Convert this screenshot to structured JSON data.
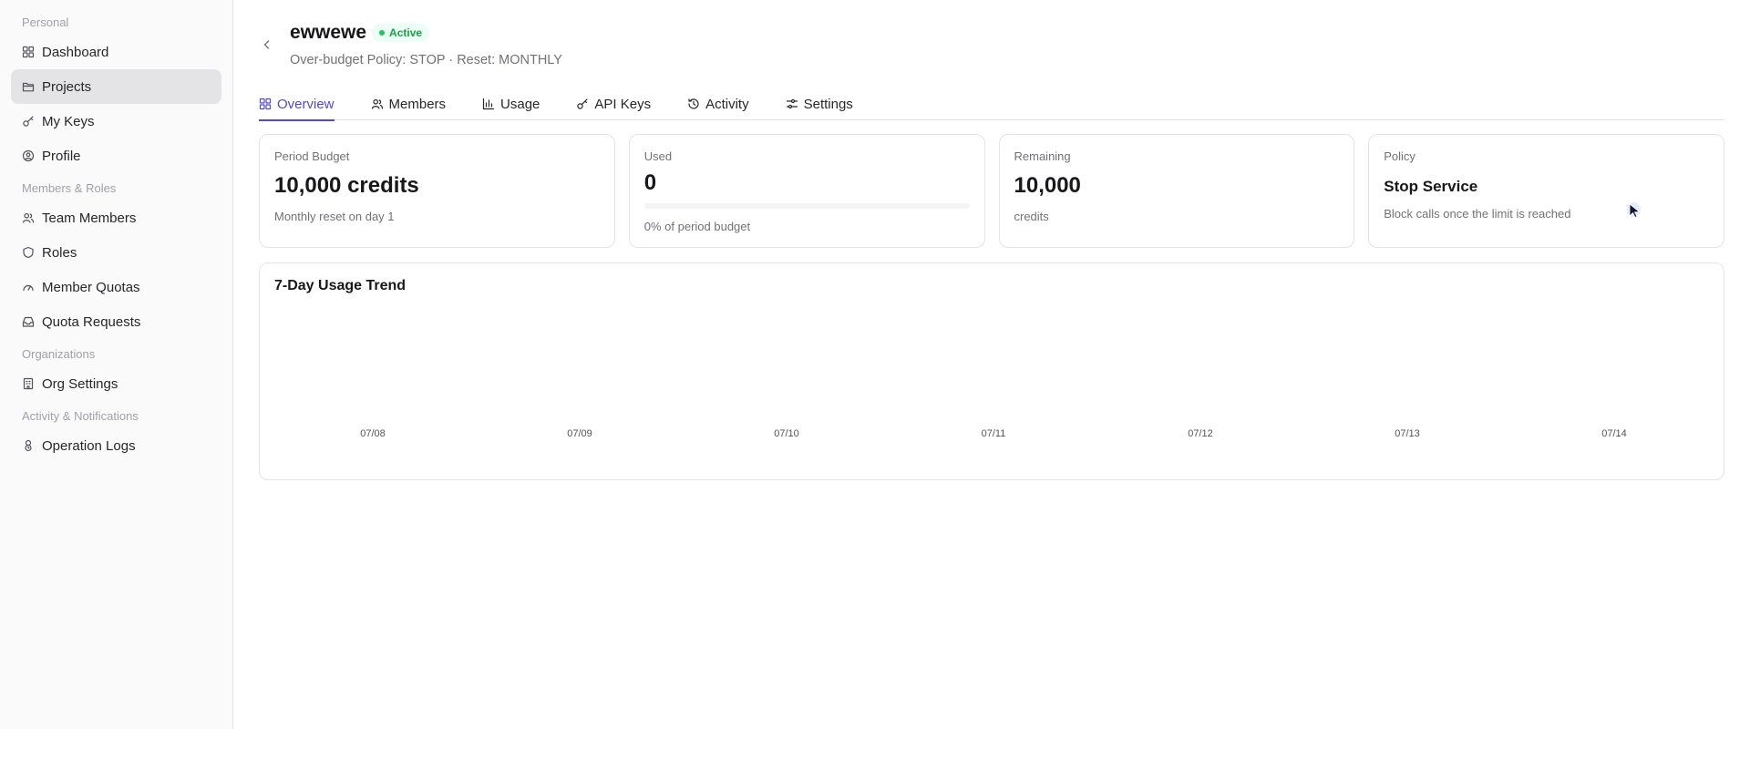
{
  "sidebar": {
    "sections": [
      {
        "label": "Personal",
        "items": [
          {
            "label": "Dashboard",
            "icon": "grid-icon"
          },
          {
            "label": "Projects",
            "icon": "folder-icon",
            "active": true
          },
          {
            "label": "My Keys",
            "icon": "key-icon"
          },
          {
            "label": "Profile",
            "icon": "user-circle-icon"
          }
        ]
      },
      {
        "label": "Members & Roles",
        "items": [
          {
            "label": "Team Members",
            "icon": "users-icon"
          },
          {
            "label": "Roles",
            "icon": "shield-icon"
          },
          {
            "label": "Member Quotas",
            "icon": "gauge-icon"
          },
          {
            "label": "Quota Requests",
            "icon": "inbox-icon"
          }
        ]
      },
      {
        "label": "Organizations",
        "items": [
          {
            "label": "Org Settings",
            "icon": "building-icon"
          }
        ]
      },
      {
        "label": "Activity & Notifications",
        "items": [
          {
            "label": "Operation Logs",
            "icon": "logs-icon"
          }
        ]
      }
    ]
  },
  "header": {
    "title": "ewwewe",
    "status": "Active",
    "subtitle": "Over-budget Policy: STOP · Reset: MONTHLY"
  },
  "tabs": [
    {
      "label": "Overview",
      "icon": "grid-icon",
      "active": true
    },
    {
      "label": "Members",
      "icon": "users-icon"
    },
    {
      "label": "Usage",
      "icon": "bar-chart-icon"
    },
    {
      "label": "API Keys",
      "icon": "key-icon"
    },
    {
      "label": "Activity",
      "icon": "history-icon"
    },
    {
      "label": "Settings",
      "icon": "sliders-icon"
    }
  ],
  "cards": {
    "budget": {
      "label": "Period Budget",
      "value": "10,000 credits",
      "sub": "Monthly reset on day 1"
    },
    "used": {
      "label": "Used",
      "value": "0",
      "progress": 0,
      "sub": "0% of period budget"
    },
    "remaining": {
      "label": "Remaining",
      "value": "10,000",
      "sub": "credits"
    },
    "policy": {
      "label": "Policy",
      "value": "Stop Service",
      "sub": "Block calls once the limit is reached"
    }
  },
  "trend": {
    "title": "7-Day Usage Trend"
  },
  "colors": {
    "accent": "#4f46e5",
    "active_status": "#16a34a"
  },
  "chart_data": {
    "type": "bar",
    "title": "7-Day Usage Trend",
    "categories": [
      "07/08",
      "07/09",
      "07/10",
      "07/11",
      "07/12",
      "07/13",
      "07/14"
    ],
    "values": [
      0,
      0,
      0,
      0,
      0,
      0,
      0
    ],
    "xlabel": "",
    "ylabel": "",
    "grid": false
  }
}
